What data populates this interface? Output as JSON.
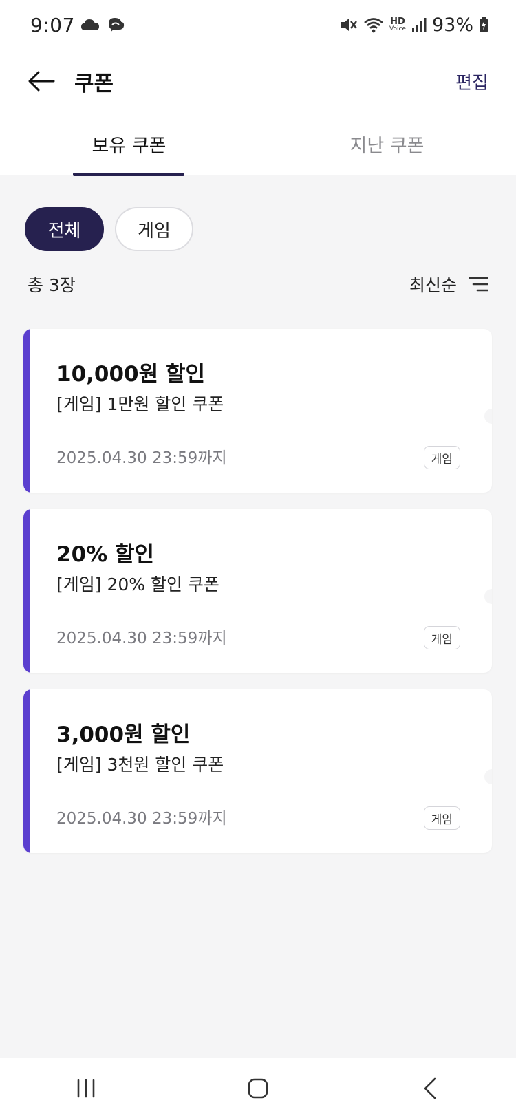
{
  "status_bar": {
    "time": "9:07",
    "battery": "93%",
    "icons": [
      "cloud-icon",
      "weather-icon",
      "mute-icon",
      "wifi-icon",
      "hd-voice-icon",
      "signal-icon",
      "battery-icon"
    ],
    "hd_label": "HD",
    "voice_label": "Voice"
  },
  "header": {
    "title": "쿠폰",
    "edit_label": "편집"
  },
  "tabs": [
    {
      "label": "보유 쿠폰",
      "active": true
    },
    {
      "label": "지난 쿠폰",
      "active": false
    }
  ],
  "filters": [
    {
      "label": "전체",
      "active": true
    },
    {
      "label": "게임",
      "active": false
    }
  ],
  "list": {
    "count_label": "총 3장",
    "sort_label": "최신순"
  },
  "coupons": [
    {
      "amount": "10,000원 할인",
      "name": "[게임] 1만원 할인 쿠폰",
      "expiry": "2025.04.30 23:59까지",
      "tag": "게임"
    },
    {
      "amount": "20% 할인",
      "name": "[게임] 20% 할인 쿠폰",
      "expiry": "2025.04.30 23:59까지",
      "tag": "게임"
    },
    {
      "amount": "3,000원 할인",
      "name": "[게임] 3천원 할인 쿠폰",
      "expiry": "2025.04.30 23:59까지",
      "tag": "게임"
    }
  ],
  "colors": {
    "accent_navy": "#26214f",
    "coupon_bar": "#5b3fcf",
    "background": "#f5f5f6"
  }
}
